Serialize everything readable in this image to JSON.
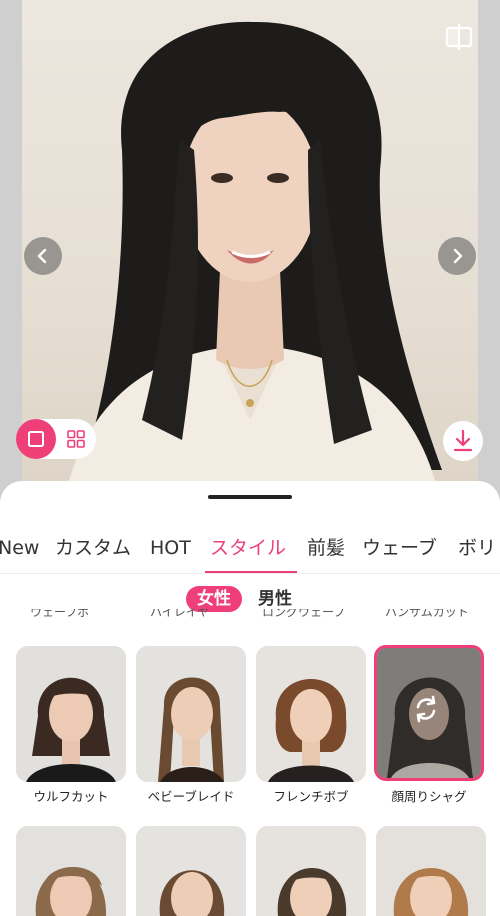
{
  "photo": {
    "alt": "hairstyle preview photo"
  },
  "controls": {
    "compare_icon": "compare-icon",
    "prev_icon": "chevron-left-icon",
    "next_icon": "chevron-right-icon",
    "single_view_icon": "single-view-icon",
    "grid_view_icon": "grid-view-icon",
    "download_icon": "download-icon"
  },
  "category_tabs": [
    {
      "label": "New"
    },
    {
      "label": "カスタム"
    },
    {
      "label": "HOT"
    },
    {
      "label": "スタイル",
      "active": true
    },
    {
      "label": "前髪"
    },
    {
      "label": "ウェーブ"
    },
    {
      "label": "ボリ"
    }
  ],
  "gender": {
    "female": "女性",
    "male": "男性",
    "selected": "女性"
  },
  "previous_row_labels": [
    "ウェーブボ",
    "ハイレイヤ",
    "ロングウェーブ",
    "ハンサムカット"
  ],
  "styles": [
    {
      "label": "ウルフカット",
      "hair": "#3a2a22"
    },
    {
      "label": "ベビーブレイド",
      "hair": "#6a4a30"
    },
    {
      "label": "フレンチボブ",
      "hair": "#7a4a2c"
    },
    {
      "label": "顔周りシャグ",
      "hair": "#2a2420",
      "selected": true
    }
  ],
  "styles_next_row": [
    {
      "hair": "#8a6a4a"
    },
    {
      "hair": "#6a4a32"
    },
    {
      "hair": "#4a3a2c"
    },
    {
      "hair": "#b07a4a"
    }
  ],
  "colors": {
    "accent": "#ee3f79"
  }
}
